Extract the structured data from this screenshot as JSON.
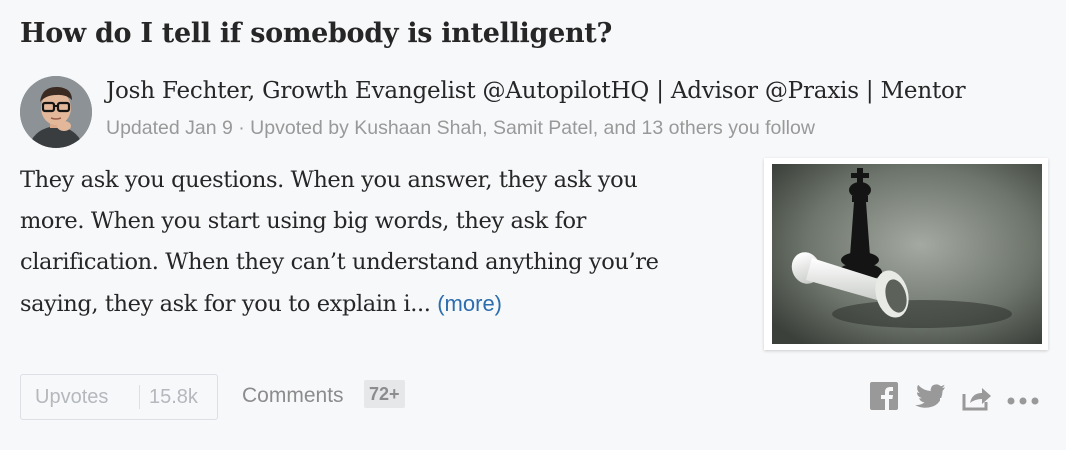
{
  "question": {
    "title": "How do I tell if somebody is intelligent?"
  },
  "author": {
    "credential_line": "Josh Fechter, Growth Evangelist @AutopilotHQ | Advisor @Praxis | Mentor",
    "meta_line": "Updated Jan 9 · Upvoted by Kushaan Shah, Samit Patel, and 13 others you follow",
    "avatar_icon": "user-avatar-photo"
  },
  "answer": {
    "lines": [
      "They ask you questions. When you answer, they ask you",
      "more. When you start using big words, they ask for",
      "clarification. When they can’t understand anything you’re",
      "saying, they ask for you to explain i..."
    ],
    "more_label": "(more)",
    "thumbnail_icon": "chess-pieces-photo"
  },
  "actions": {
    "upvote_label": "Upvotes",
    "upvote_count": "15.8k",
    "comments_label": "Comments",
    "comments_count": "72+",
    "share_icons": [
      "facebook-icon",
      "twitter-icon",
      "share-icon",
      "more-options-icon"
    ],
    "colors": {
      "icon_gray": "#999999",
      "link_blue": "#2b6dad"
    }
  }
}
